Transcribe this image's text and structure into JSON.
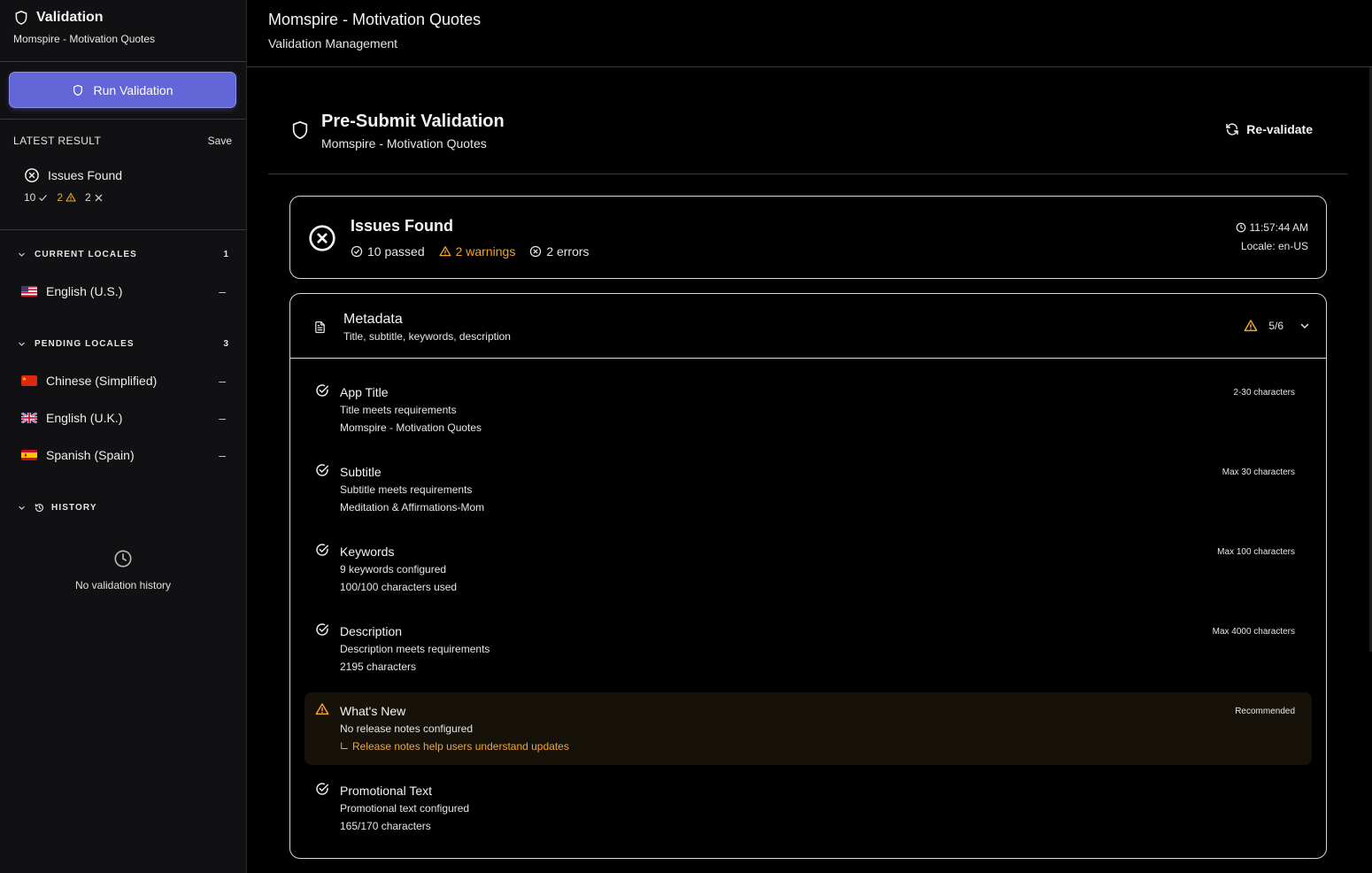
{
  "sidebar": {
    "title": "Validation",
    "subtitle": "Momspire - Motivation Quotes",
    "run_button": "Run Validation",
    "latest": {
      "label": "LATEST RESULT",
      "save": "Save",
      "status": "Issues Found",
      "passed": "10",
      "warnings": "2",
      "errors": "2"
    },
    "current_locales": {
      "label": "CURRENT LOCALES",
      "count": "1",
      "items": [
        {
          "name": "English (U.S.)",
          "status": "–",
          "flag": "us"
        }
      ]
    },
    "pending_locales": {
      "label": "PENDING LOCALES",
      "count": "3",
      "items": [
        {
          "name": "Chinese (Simplified)",
          "status": "–",
          "flag": "cn"
        },
        {
          "name": "English (U.K.)",
          "status": "–",
          "flag": "gb"
        },
        {
          "name": "Spanish (Spain)",
          "status": "–",
          "flag": "es"
        }
      ]
    },
    "history": {
      "label": "HISTORY",
      "empty": "No validation history"
    }
  },
  "header": {
    "title": "Momspire - Motivation Quotes",
    "subtitle": "Validation Management"
  },
  "validation": {
    "title": "Pre-Submit Validation",
    "subtitle": "Momspire - Motivation Quotes",
    "revalidate": "Re-validate"
  },
  "result": {
    "title": "Issues Found",
    "passed": "10 passed",
    "warnings": "2 warnings",
    "errors": "2 errors",
    "time": "11:57:44 AM",
    "locale": "Locale: en-US"
  },
  "metadata": {
    "title": "Metadata",
    "subtitle": "Title, subtitle, keywords, description",
    "score": "5/6",
    "checks": [
      {
        "title": "App Title",
        "line1": "Title meets requirements",
        "line2": "Momspire - Motivation Quotes",
        "requirement": "2-30 characters",
        "status": "pass"
      },
      {
        "title": "Subtitle",
        "line1": "Subtitle meets requirements",
        "line2": "Meditation & Affirmations-Mom",
        "requirement": "Max 30 characters",
        "status": "pass"
      },
      {
        "title": "Keywords",
        "line1": "9 keywords configured",
        "line2": "100/100 characters used",
        "requirement": "Max 100 characters",
        "status": "pass"
      },
      {
        "title": "Description",
        "line1": "Description meets requirements",
        "line2": "2195 characters",
        "requirement": "Max 4000 characters",
        "status": "pass"
      },
      {
        "title": "What's New",
        "line1": "No release notes configured",
        "line2": "Release notes help users understand updates",
        "requirement": "Recommended",
        "status": "warning"
      },
      {
        "title": "Promotional Text",
        "line1": "Promotional text configured",
        "line2": "165/170 characters",
        "requirement": "",
        "status": "pass"
      }
    ]
  },
  "colors": {
    "accent": "#6266d6",
    "warning": "#f0a531",
    "background": "#000000",
    "sidebar": "#111113"
  }
}
